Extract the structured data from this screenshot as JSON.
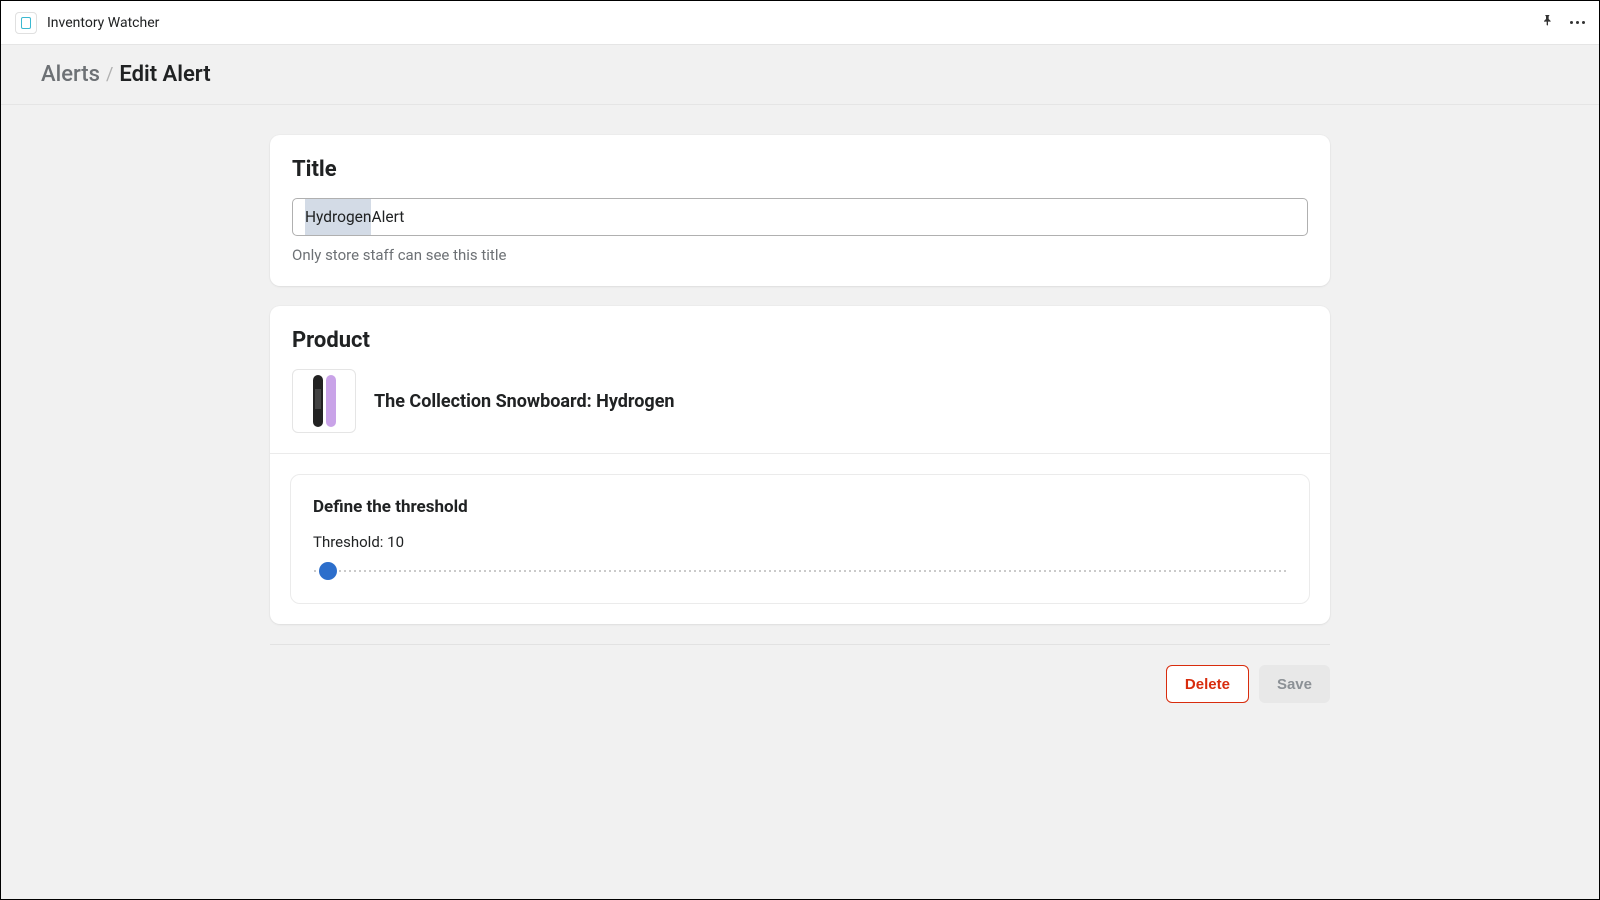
{
  "header": {
    "app_name": "Inventory Watcher"
  },
  "breadcrumb": {
    "parent": "Alerts",
    "current": "Edit Alert"
  },
  "title_card": {
    "heading": "Title",
    "input_value_selected": "Hydrogen",
    "input_value_rest": " Alert",
    "help_text": "Only store staff can see this title"
  },
  "product_card": {
    "heading": "Product",
    "product_name": "The Collection Snowboard: Hydrogen",
    "threshold_heading": "Define the threshold",
    "threshold_label_prefix": "Threshold: ",
    "threshold_value": "10"
  },
  "actions": {
    "delete_label": "Delete",
    "save_label": "Save"
  }
}
